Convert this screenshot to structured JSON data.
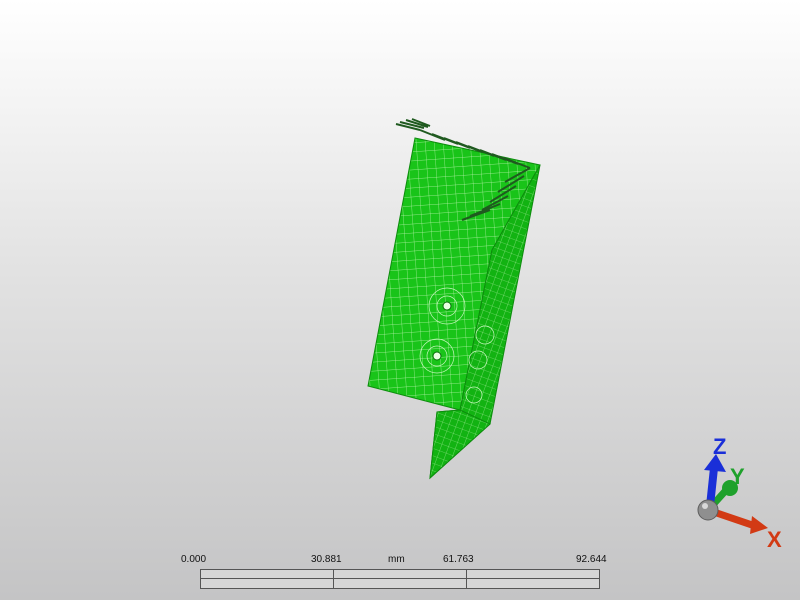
{
  "viewport": {
    "background_top": "#ffffff",
    "background_bottom": "#c4c4c5",
    "mesh_color": "#16c316",
    "mesh_line_color": "#b9f5b0",
    "fixture_color": "#1f5a1f"
  },
  "triad": {
    "z_label": "Z",
    "y_label": "Y",
    "x_label": "X",
    "z_color": "#1a2fd8",
    "y_color": "#1fa12c",
    "x_color": "#d23a14"
  },
  "scale_bar": {
    "tick_0": "0.000",
    "tick_1": "30.881",
    "unit": "mm",
    "tick_2": "61.763",
    "tick_3": "92.644"
  }
}
